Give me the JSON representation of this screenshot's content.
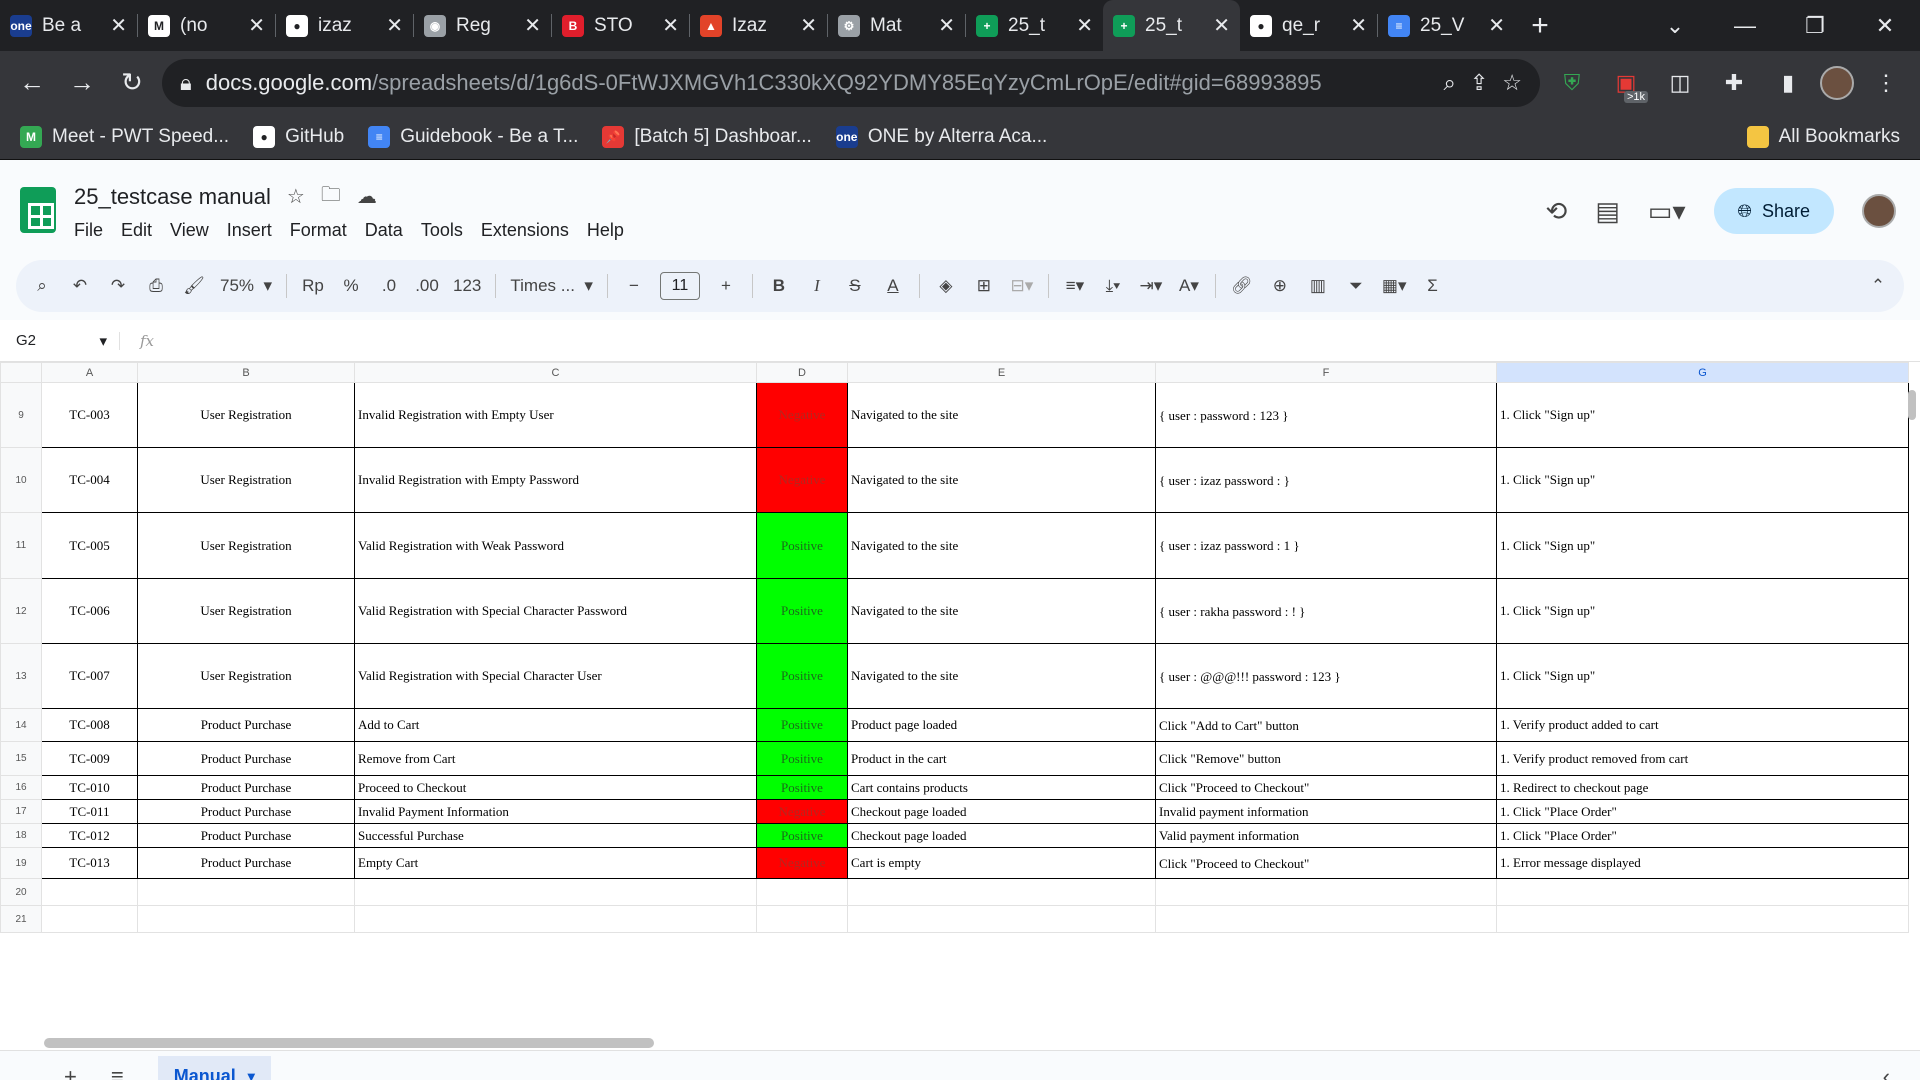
{
  "browser": {
    "tabs": [
      {
        "title": "Be a",
        "fav_color": "#1a3d8f",
        "fav_text": "one"
      },
      {
        "title": "(no",
        "fav_color": "#ffffff",
        "fav_text": "M"
      },
      {
        "title": "izaz",
        "fav_color": "#ffffff",
        "fav_text": "●"
      },
      {
        "title": "Reg",
        "fav_color": "#9aa0a6",
        "fav_text": "◉"
      },
      {
        "title": "STO",
        "fav_color": "#e01e2c",
        "fav_text": "B"
      },
      {
        "title": "Izaz",
        "fav_color": "#e24329",
        "fav_text": "▲"
      },
      {
        "title": "Mat",
        "fav_color": "#9aa0a6",
        "fav_text": "⚙"
      },
      {
        "title": "25_t",
        "fav_color": "#0f9d58",
        "fav_text": "+"
      },
      {
        "title": "25_t",
        "fav_color": "#0f9d58",
        "fav_text": "+",
        "active": true
      },
      {
        "title": "qe_r",
        "fav_color": "#ffffff",
        "fav_text": "●"
      },
      {
        "title": "25_V",
        "fav_color": "#4285f4",
        "fav_text": "≡"
      }
    ],
    "url_host": "docs.google.com",
    "url_path": "/spreadsheets/d/1g6dS-0FtWJXMGVh1C330kXQ92YDMY85EqYzyCmLrOpE/edit#gid=68993895",
    "ext_badge": ">1k",
    "bookmarks": [
      {
        "label": "Meet - PWT Speed...",
        "color": "#34a853",
        "icon": "M"
      },
      {
        "label": "GitHub",
        "color": "#ffffff",
        "icon": "●"
      },
      {
        "label": "Guidebook - Be a T...",
        "color": "#4285f4",
        "icon": "≡"
      },
      {
        "label": "[Batch 5] Dashboar...",
        "color": "#e53935",
        "icon": "📌"
      },
      {
        "label": "ONE by Alterra Aca...",
        "color": "#1a3d8f",
        "icon": "one"
      }
    ],
    "all_bookmarks": "All Bookmarks"
  },
  "doc": {
    "title": "25_testcase manual",
    "menus": [
      "File",
      "Edit",
      "View",
      "Insert",
      "Format",
      "Data",
      "Tools",
      "Extensions",
      "Help"
    ],
    "share_label": "Share"
  },
  "toolbar": {
    "zoom": "75%",
    "currency": "Rp",
    "percent": "%",
    "dec_decrease": ".0",
    "dec_increase": ".00",
    "format_123": "123",
    "font": "Times ...",
    "font_size": "11"
  },
  "formula_bar": {
    "cell_ref": "G2",
    "fx": "fx"
  },
  "grid": {
    "columns": [
      "A",
      "B",
      "C",
      "D",
      "E",
      "F",
      "G"
    ],
    "selected_column": "G",
    "rows": [
      {
        "num": "9",
        "id": "TC-003",
        "feature": "User Registration",
        "scenario": "Invalid Registration with Empty User",
        "type": "Negative",
        "precondition": "Navigated to the site",
        "data": "{\nuser :\npassword : 123\n}",
        "steps": "1. Click \"Sign up\""
      },
      {
        "num": "10",
        "id": "TC-004",
        "feature": "User Registration",
        "scenario": "Invalid Registration with Empty Password",
        "type": "Negative",
        "precondition": "Navigated to the site",
        "data": "{\nuser : izaz\npassword :\n}",
        "steps": "1. Click \"Sign up\""
      },
      {
        "num": "11",
        "id": "TC-005",
        "feature": "User Registration",
        "scenario": "Valid Registration with Weak Password",
        "type": "Positive",
        "precondition": "Navigated to the site",
        "data": "{\nuser : izaz\npassword : 1\n}",
        "steps": "1. Click \"Sign up\""
      },
      {
        "num": "12",
        "id": "TC-006",
        "feature": "User Registration",
        "scenario": "Valid Registration with Special Character Password",
        "type": "Positive",
        "precondition": "Navigated to the site",
        "data": "{\nuser : rakha\npassword : !\n}",
        "steps": "1. Click \"Sign up\""
      },
      {
        "num": "13",
        "id": "TC-007",
        "feature": "User Registration",
        "scenario": "Valid Registration with Special Character User",
        "type": "Positive",
        "precondition": "Navigated to the site",
        "data": "{\nuser : @@@!!!\npassword : 123\n}",
        "steps": "1. Click \"Sign up\""
      },
      {
        "num": "14",
        "id": "TC-008",
        "feature": "Product Purchase",
        "scenario": "Add to Cart",
        "type": "Positive",
        "precondition": "Product page loaded",
        "data": "Click \"Add to Cart\" button",
        "steps": "1. Verify product added to cart"
      },
      {
        "num": "15",
        "id": "TC-009",
        "feature": "Product Purchase",
        "scenario": "Remove from Cart",
        "type": "Positive",
        "precondition": "Product in the cart",
        "data": "Click \"Remove\" button",
        "steps": "1. Verify product removed from cart"
      },
      {
        "num": "16",
        "id": "TC-010",
        "feature": "Product Purchase",
        "scenario": "Proceed to Checkout",
        "type": "Positive",
        "precondition": "Cart contains products",
        "data": "Click \"Proceed to Checkout\"",
        "steps": "1. Redirect to checkout page"
      },
      {
        "num": "17",
        "id": "TC-011",
        "feature": "Product Purchase",
        "scenario": "Invalid Payment Information",
        "type": "Negative",
        "precondition": "Checkout page loaded",
        "data": "Invalid payment information",
        "steps": "1. Click \"Place Order\""
      },
      {
        "num": "18",
        "id": "TC-012",
        "feature": "Product Purchase",
        "scenario": "Successful Purchase",
        "type": "Positive",
        "precondition": "Checkout page loaded",
        "data": "Valid payment information",
        "steps": "1. Click \"Place Order\""
      },
      {
        "num": "19",
        "id": "TC-013",
        "feature": "Product Purchase",
        "scenario": "Empty Cart",
        "type": "Negative",
        "precondition": "Cart is empty",
        "data": "Click \"Proceed to Checkout\"",
        "steps": "1. Error message displayed"
      }
    ],
    "empty_rows": [
      "20",
      "21"
    ],
    "colors": {
      "negative": "#ff0000",
      "positive": "#00ff00"
    }
  },
  "sheet_tabs": {
    "active": "Manual"
  }
}
